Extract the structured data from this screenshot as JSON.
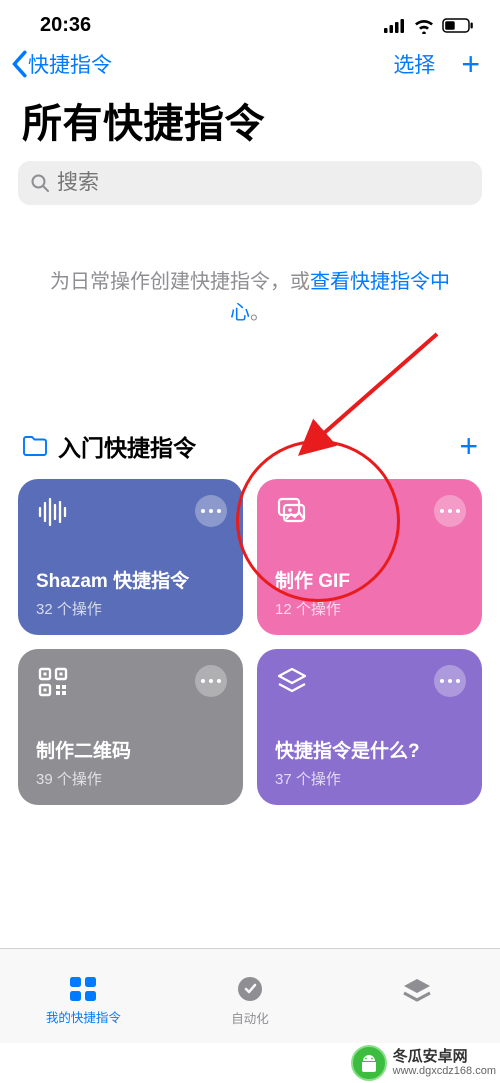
{
  "status": {
    "time": "20:36"
  },
  "nav": {
    "back_label": "快捷指令",
    "select": "选择"
  },
  "page_title": "所有快捷指令",
  "search": {
    "placeholder": "搜索"
  },
  "info": {
    "pre": "为日常操作创建快捷指令，或",
    "link": "查看快捷指令中心",
    "post": "。"
  },
  "section": {
    "title": "入门快捷指令"
  },
  "cards": [
    {
      "title": "Shazam 快捷指令",
      "sub": "32 个操作"
    },
    {
      "title": "制作 GIF",
      "sub": "12 个操作"
    },
    {
      "title": "制作二维码",
      "sub": "39 个操作"
    },
    {
      "title": "快捷指令是什么?",
      "sub": "37 个操作"
    }
  ],
  "tabs": {
    "mine": "我的快捷指令",
    "automation": "自动化"
  },
  "watermark": {
    "title": "冬瓜安卓网",
    "url": "www.dgxcdz168.com"
  },
  "colors": {
    "accent": "#007aff"
  }
}
